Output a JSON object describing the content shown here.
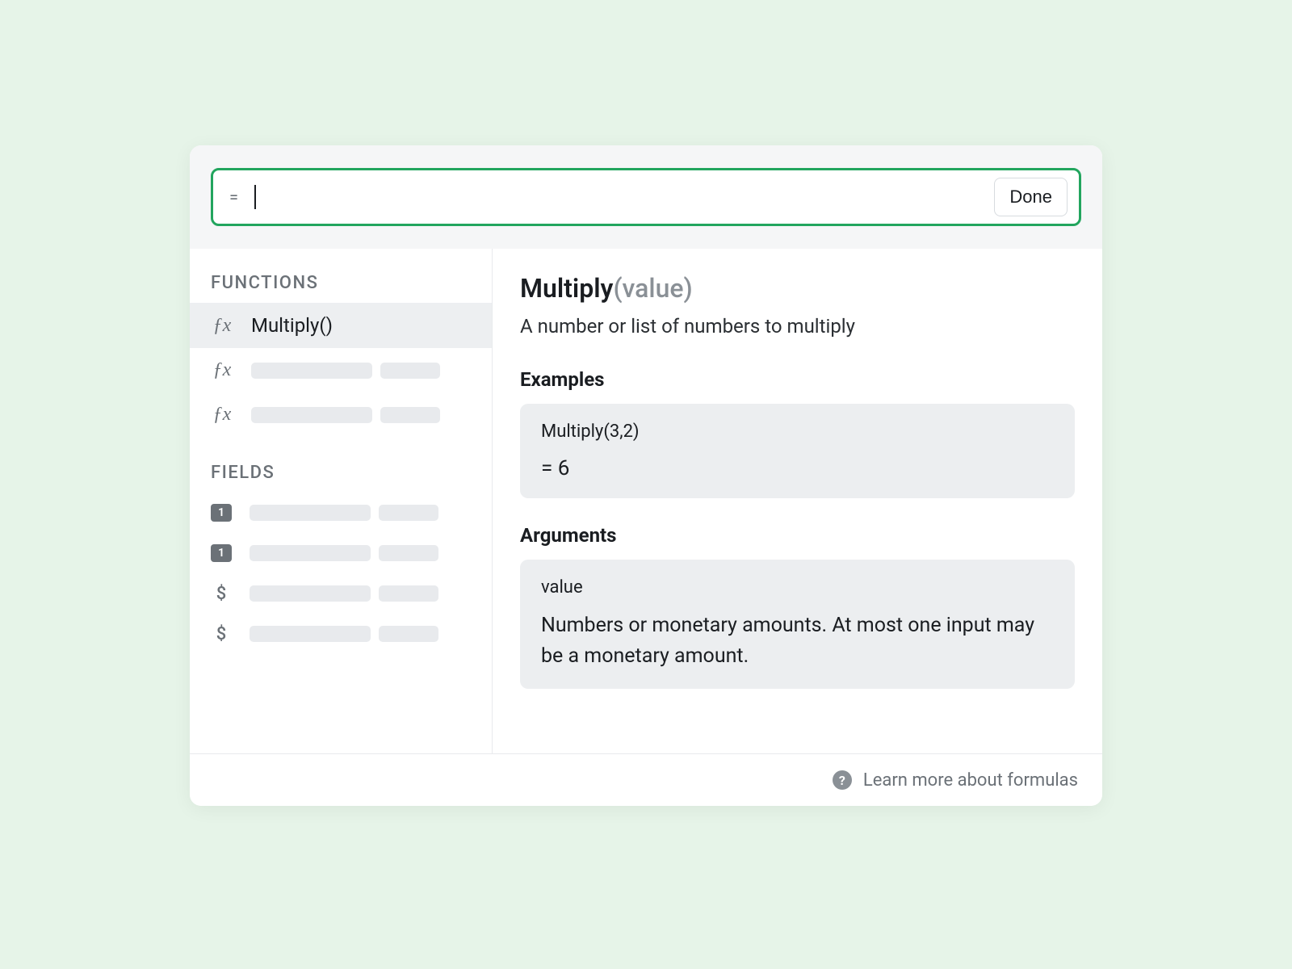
{
  "formula_bar": {
    "prefix": "=",
    "value": "",
    "done_label": "Done"
  },
  "sidebar": {
    "functions_label": "FUNCTIONS",
    "fields_label": "FIELDS",
    "functions": [
      {
        "icon": "fx",
        "label": "Multiply()",
        "selected": true
      },
      {
        "icon": "fx",
        "label": "",
        "selected": false
      },
      {
        "icon": "fx",
        "label": "",
        "selected": false
      }
    ],
    "fields": [
      {
        "icon_type": "number",
        "icon_text": "1"
      },
      {
        "icon_type": "number",
        "icon_text": "1"
      },
      {
        "icon_type": "currency",
        "icon_text": "$"
      },
      {
        "icon_type": "currency",
        "icon_text": "$"
      }
    ]
  },
  "details": {
    "fn_name": "Multiply",
    "fn_signature": "(value)",
    "description": "A number or list of numbers to multiply",
    "examples_heading": "Examples",
    "example_call": "Multiply(3,2)",
    "example_result": "= 6",
    "arguments_heading": "Arguments",
    "argument_name": "value",
    "argument_desc": "Numbers or monetary amounts. At most one input may be a monetary amount."
  },
  "footer": {
    "link_label": "Learn more about formulas"
  }
}
